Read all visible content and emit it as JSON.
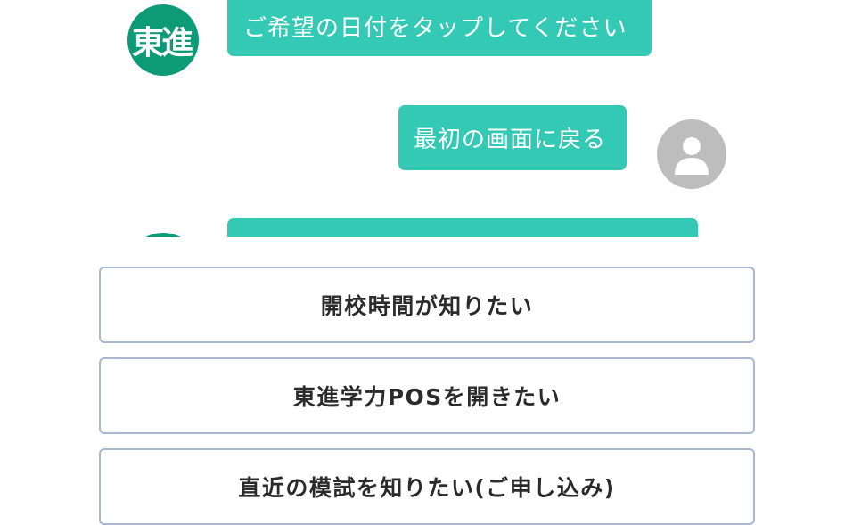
{
  "chat": {
    "bot_logo_text": "東進",
    "messages": [
      {
        "sender": "bot",
        "text": "ご希望の日付をタップしてください"
      },
      {
        "sender": "user",
        "text": "最初の画面に戻る"
      },
      {
        "sender": "bot",
        "text": ""
      }
    ],
    "colors": {
      "bot_avatar": "#0d9a76",
      "bubble": "#34c9b4",
      "user_avatar": "#bdbdbd"
    },
    "user_avatar_icon": "user-silhouette-icon"
  },
  "options": [
    {
      "label": "開校時間が知りたい"
    },
    {
      "label": "東進学力POSを開きたい"
    },
    {
      "label": "直近の模試を知りたい(ご申し込み)"
    }
  ]
}
